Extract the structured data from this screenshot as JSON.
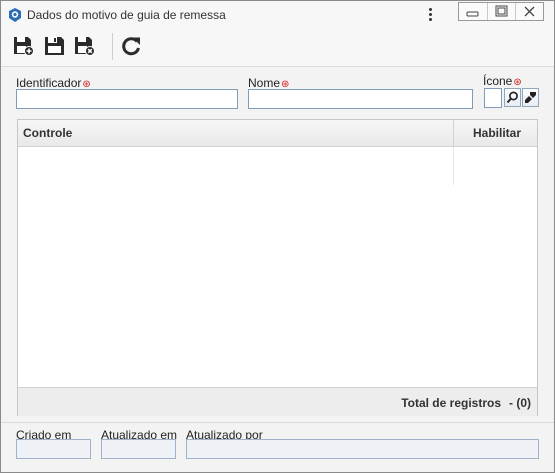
{
  "window": {
    "title": "Dados do motivo de guia de remessa",
    "accent": "#2c6fb7"
  },
  "toolbar": {
    "buttons": [
      {
        "icon": "save-new-icon"
      },
      {
        "icon": "save-icon"
      },
      {
        "icon": "save-close-icon"
      },
      {
        "icon": "refresh-icon"
      }
    ]
  },
  "form": {
    "identificador": {
      "label": "Identificador",
      "value": "",
      "required": true
    },
    "nome": {
      "label": "Nome",
      "value": "",
      "required": true
    },
    "icone": {
      "label": "Ícone",
      "required": true,
      "search_icon": "search-icon",
      "clear_icon": "eraser-icon"
    },
    "required_marker": "⊛"
  },
  "grid": {
    "columns": [
      "Controle",
      "Habilitar"
    ],
    "rows": [],
    "total_label": "Total de registros",
    "total_count": "- (0)"
  },
  "footer": {
    "created_label": "Criado em",
    "created_value": "",
    "updated_label": "Atualizado em",
    "updated_value": "",
    "updated_by_label": "Atualizado por",
    "updated_by_value": ""
  }
}
